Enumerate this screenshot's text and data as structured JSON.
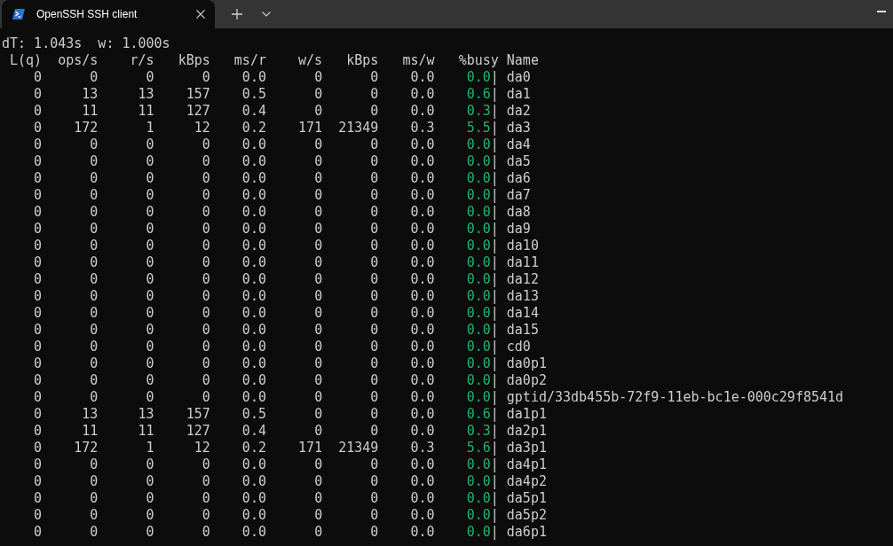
{
  "window": {
    "tabs": [
      {
        "title": "OpenSSH SSH client",
        "selected": true
      }
    ]
  },
  "terminal": {
    "status": [
      "dT: 1.043s",
      "w: 1.000s"
    ],
    "columns": [
      "L(q)",
      "ops/s",
      "r/s",
      "kBps",
      "ms/r",
      "w/s",
      "kBps",
      "ms/w",
      "%busy",
      "Name"
    ],
    "rows": [
      {
        "values": [
          "0",
          "0",
          "0",
          "0",
          "0.0",
          "0",
          "0",
          "0.0"
        ],
        "busy": "0.0",
        "bar": "|",
        "name": "da0"
      },
      {
        "values": [
          "0",
          "13",
          "13",
          "157",
          "0.5",
          "0",
          "0",
          "0.0"
        ],
        "busy": "0.6",
        "bar": "|",
        "name": "da1"
      },
      {
        "values": [
          "0",
          "11",
          "11",
          "127",
          "0.4",
          "0",
          "0",
          "0.0"
        ],
        "busy": "0.3",
        "bar": "|",
        "name": "da2"
      },
      {
        "values": [
          "0",
          "172",
          "1",
          "12",
          "0.2",
          "171",
          "21349",
          "0.3"
        ],
        "busy": "5.5",
        "bar": "|",
        "name": "da3"
      },
      {
        "values": [
          "0",
          "0",
          "0",
          "0",
          "0.0",
          "0",
          "0",
          "0.0"
        ],
        "busy": "0.0",
        "bar": "|",
        "name": "da4"
      },
      {
        "values": [
          "0",
          "0",
          "0",
          "0",
          "0.0",
          "0",
          "0",
          "0.0"
        ],
        "busy": "0.0",
        "bar": "|",
        "name": "da5"
      },
      {
        "values": [
          "0",
          "0",
          "0",
          "0",
          "0.0",
          "0",
          "0",
          "0.0"
        ],
        "busy": "0.0",
        "bar": "|",
        "name": "da6"
      },
      {
        "values": [
          "0",
          "0",
          "0",
          "0",
          "0.0",
          "0",
          "0",
          "0.0"
        ],
        "busy": "0.0",
        "bar": "|",
        "name": "da7"
      },
      {
        "values": [
          "0",
          "0",
          "0",
          "0",
          "0.0",
          "0",
          "0",
          "0.0"
        ],
        "busy": "0.0",
        "bar": "|",
        "name": "da8"
      },
      {
        "values": [
          "0",
          "0",
          "0",
          "0",
          "0.0",
          "0",
          "0",
          "0.0"
        ],
        "busy": "0.0",
        "bar": "|",
        "name": "da9"
      },
      {
        "values": [
          "0",
          "0",
          "0",
          "0",
          "0.0",
          "0",
          "0",
          "0.0"
        ],
        "busy": "0.0",
        "bar": "|",
        "name": "da10"
      },
      {
        "values": [
          "0",
          "0",
          "0",
          "0",
          "0.0",
          "0",
          "0",
          "0.0"
        ],
        "busy": "0.0",
        "bar": "|",
        "name": "da11"
      },
      {
        "values": [
          "0",
          "0",
          "0",
          "0",
          "0.0",
          "0",
          "0",
          "0.0"
        ],
        "busy": "0.0",
        "bar": "|",
        "name": "da12"
      },
      {
        "values": [
          "0",
          "0",
          "0",
          "0",
          "0.0",
          "0",
          "0",
          "0.0"
        ],
        "busy": "0.0",
        "bar": "|",
        "name": "da13"
      },
      {
        "values": [
          "0",
          "0",
          "0",
          "0",
          "0.0",
          "0",
          "0",
          "0.0"
        ],
        "busy": "0.0",
        "bar": "|",
        "name": "da14"
      },
      {
        "values": [
          "0",
          "0",
          "0",
          "0",
          "0.0",
          "0",
          "0",
          "0.0"
        ],
        "busy": "0.0",
        "bar": "|",
        "name": "da15"
      },
      {
        "values": [
          "0",
          "0",
          "0",
          "0",
          "0.0",
          "0",
          "0",
          "0.0"
        ],
        "busy": "0.0",
        "bar": "|",
        "name": "cd0"
      },
      {
        "values": [
          "0",
          "0",
          "0",
          "0",
          "0.0",
          "0",
          "0",
          "0.0"
        ],
        "busy": "0.0",
        "bar": "|",
        "name": "da0p1"
      },
      {
        "values": [
          "0",
          "0",
          "0",
          "0",
          "0.0",
          "0",
          "0",
          "0.0"
        ],
        "busy": "0.0",
        "bar": "|",
        "name": "da0p2"
      },
      {
        "values": [
          "0",
          "0",
          "0",
          "0",
          "0.0",
          "0",
          "0",
          "0.0"
        ],
        "busy": "0.0",
        "bar": "|",
        "name": "gptid/33db455b-72f9-11eb-bc1e-000c29f8541d"
      },
      {
        "values": [
          "0",
          "13",
          "13",
          "157",
          "0.5",
          "0",
          "0",
          "0.0"
        ],
        "busy": "0.6",
        "bar": "|",
        "name": "da1p1"
      },
      {
        "values": [
          "0",
          "11",
          "11",
          "127",
          "0.4",
          "0",
          "0",
          "0.0"
        ],
        "busy": "0.3",
        "bar": "|",
        "name": "da2p1"
      },
      {
        "values": [
          "0",
          "172",
          "1",
          "12",
          "0.2",
          "171",
          "21349",
          "0.3"
        ],
        "busy": "5.6",
        "bar": "|",
        "name": "da3p1"
      },
      {
        "values": [
          "0",
          "0",
          "0",
          "0",
          "0.0",
          "0",
          "0",
          "0.0"
        ],
        "busy": "0.0",
        "bar": "|",
        "name": "da4p1"
      },
      {
        "values": [
          "0",
          "0",
          "0",
          "0",
          "0.0",
          "0",
          "0",
          "0.0"
        ],
        "busy": "0.0",
        "bar": "|",
        "name": "da4p2"
      },
      {
        "values": [
          "0",
          "0",
          "0",
          "0",
          "0.0",
          "0",
          "0",
          "0.0"
        ],
        "busy": "0.0",
        "bar": "|",
        "name": "da5p1"
      },
      {
        "values": [
          "0",
          "0",
          "0",
          "0",
          "0.0",
          "0",
          "0",
          "0.0"
        ],
        "busy": "0.0",
        "bar": "|",
        "name": "da5p2"
      },
      {
        "values": [
          "0",
          "0",
          "0",
          "0",
          "0.0",
          "0",
          "0",
          "0.0"
        ],
        "busy": "0.0",
        "bar": "|",
        "name": "da6p1"
      }
    ]
  }
}
